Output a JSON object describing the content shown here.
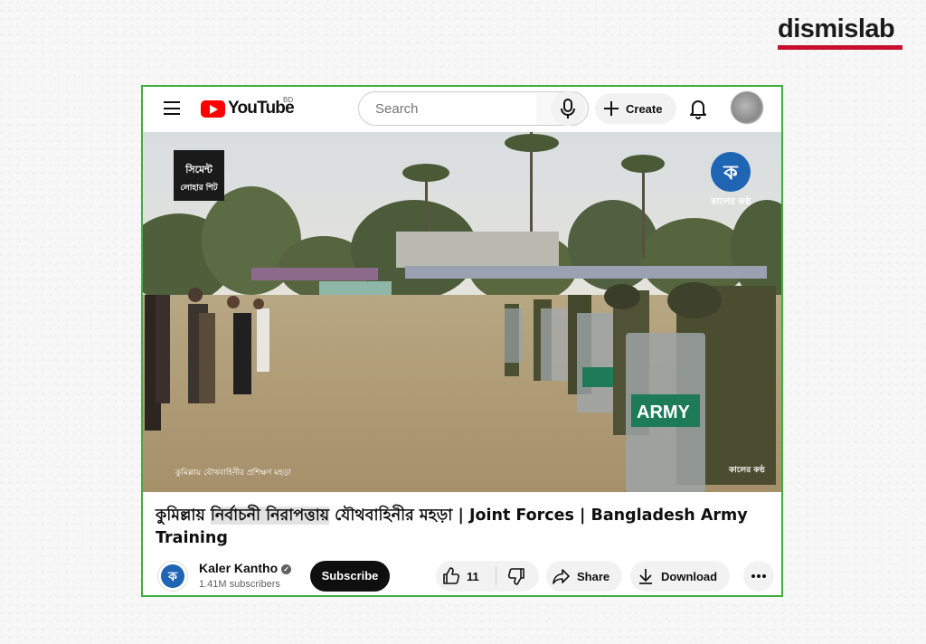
{
  "brand": {
    "name": "dismislab",
    "accent": "#c8102e"
  },
  "frame": {
    "border_color": "#3fae3f"
  },
  "youtube": {
    "logo_text": "YouTube",
    "country_code": "BD",
    "search_placeholder": "Search",
    "create_label": "Create"
  },
  "video": {
    "overlay_top_left": [
      "সিমেন্ট",
      "লোহার শিট"
    ],
    "channel_watermark": "কালের কণ্ঠ",
    "caption_bottom_left": "কুমিল্লায় যৌথবাহিনীর প্রশিক্ষণ মহড়া",
    "caption_bottom_right": "কালের কণ্ঠ",
    "shield_text": "ARMY"
  },
  "title": {
    "part1": "কুমিল্লায় ",
    "highlight": "নির্বাচনী নিরাপত্তায়",
    "part2": " যৌথবাহিনীর মহড়া | Joint Forces | Bangladesh Army Training"
  },
  "channel": {
    "name": "Kaler Kantho",
    "subscribers": "1.41M subscribers",
    "subscribe_label": "Subscribe"
  },
  "actions": {
    "likes": "11",
    "share_label": "Share",
    "download_label": "Download"
  }
}
